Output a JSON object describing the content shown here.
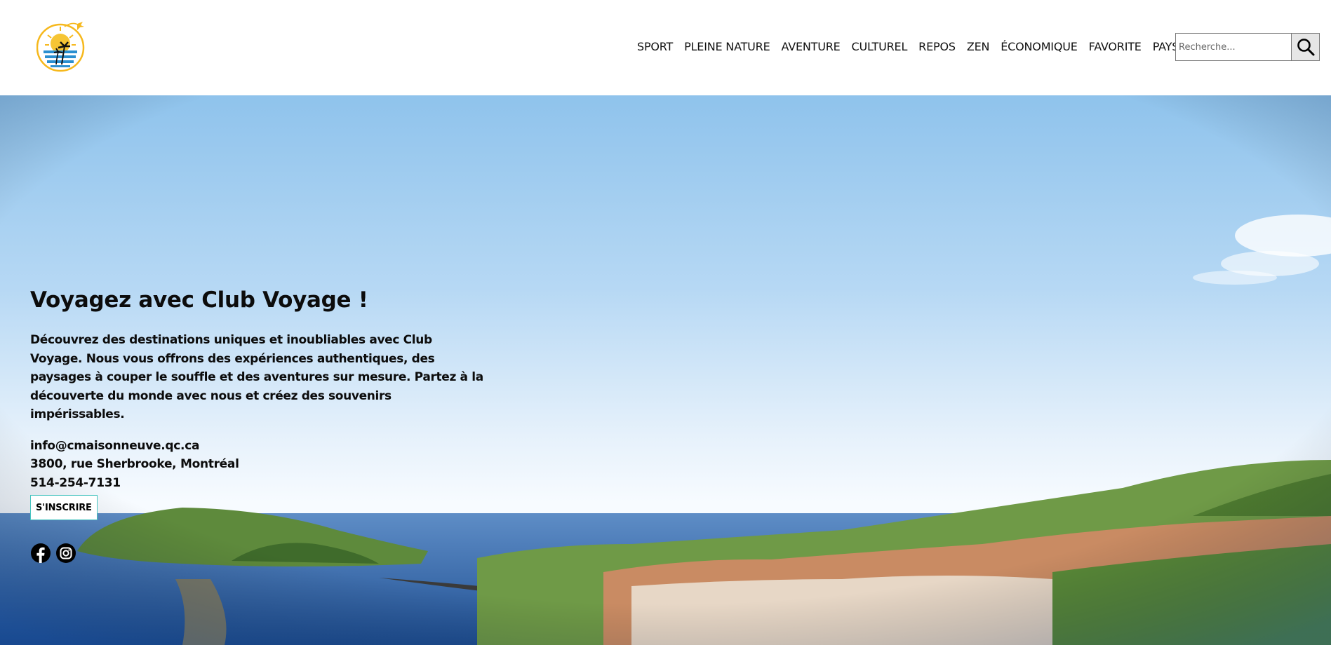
{
  "nav": {
    "items": [
      "SPORT",
      "PLEINE NATURE",
      "AVENTURE",
      "CULTUREL",
      "REPOS",
      "ZEN",
      "ÉCONOMIQUE",
      "FAVORITE",
      "PAYS"
    ]
  },
  "search": {
    "placeholder": "Recherche...",
    "button_icon": "search-icon"
  },
  "hero": {
    "title": "Voyagez avec Club Voyage !",
    "description": "Découvrez des destinations uniques et inoubliables avec Club Voyage. Nous vous offrons des expériences authentiques, des paysages à couper le souffle et des aventures sur mesure. Partez à la découverte du monde avec nous et créez des souvenirs impérissables.",
    "email": "info@cmaisonneuve.qc.ca",
    "address": "3800, rue Sherbrooke, Montréal",
    "phone": "514-254-7131",
    "signup_label": "S'INSCRIRE"
  },
  "socials": [
    "facebook-icon",
    "instagram-icon"
  ],
  "colors": {
    "signup_border": "#46c4c0",
    "logo_sun": "#f6b81c",
    "logo_sea": "#2a8fd0"
  }
}
